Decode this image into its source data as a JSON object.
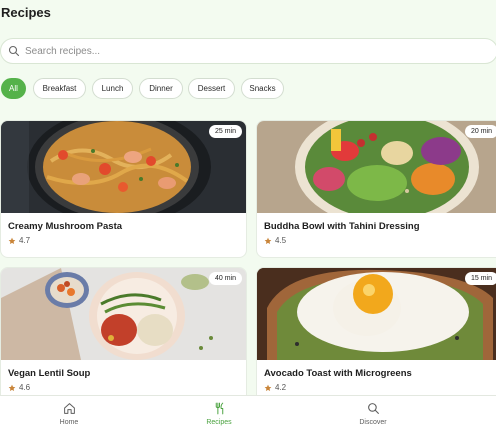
{
  "page": {
    "title": "Recipes"
  },
  "search": {
    "placeholder": "Search recipes..."
  },
  "filters": [
    "All",
    "Breakfast",
    "Lunch",
    "Dinner",
    "Dessert",
    "Snacks"
  ],
  "active_filter": "All",
  "recipes": [
    {
      "title": "Creamy Mushroom Pasta",
      "rating": "4.7",
      "time": "25 min"
    },
    {
      "title": "Buddha Bowl with Tahini Dressing",
      "rating": "4.5",
      "time": "20 min"
    },
    {
      "title": "Vegan Lentil Soup",
      "rating": "4.6",
      "time": "40 min"
    },
    {
      "title": "Avocado Toast with Microgreens",
      "rating": "4.2",
      "time": "15 min"
    }
  ],
  "nav": [
    {
      "label": "Home",
      "icon": "home-icon"
    },
    {
      "label": "Recipes",
      "icon": "utensils-icon"
    },
    {
      "label": "Discover",
      "icon": "search-icon"
    }
  ],
  "active_nav": "Recipes",
  "colors": {
    "accent": "#55b24a",
    "star": "#c9853a",
    "background": "#f3fbf0"
  }
}
